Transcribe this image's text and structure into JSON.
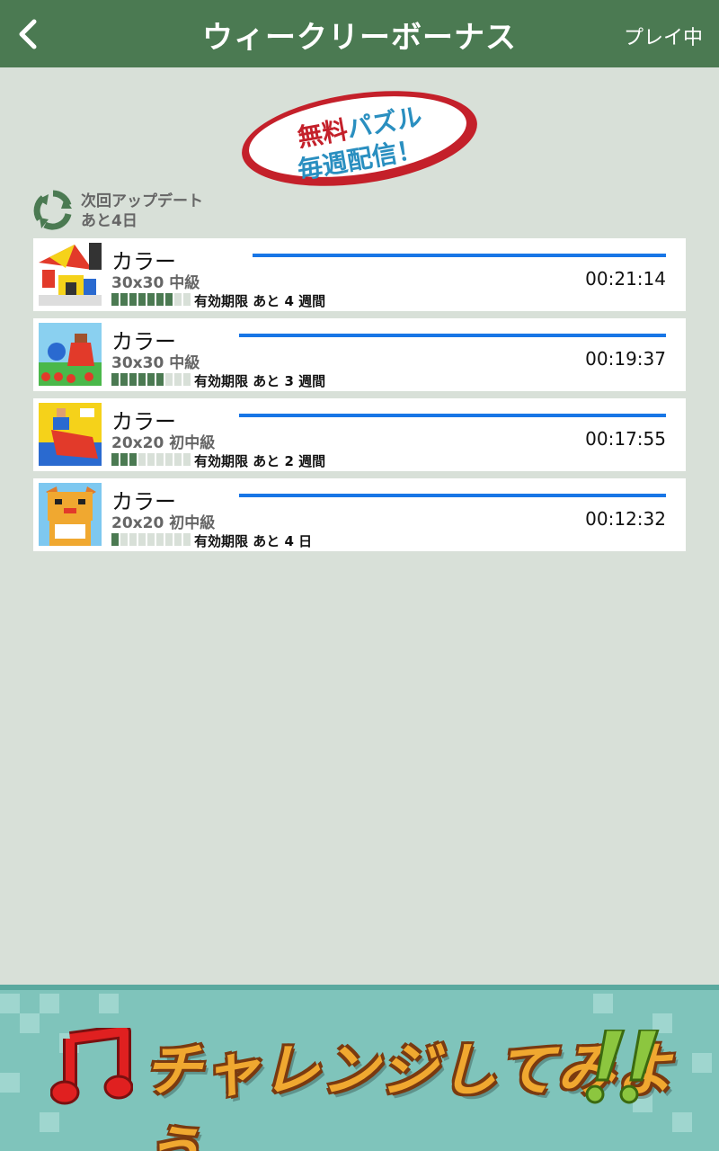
{
  "header": {
    "back_label": "<",
    "title": "ウィークリーボーナス",
    "right_label": "プレイ中"
  },
  "badge": {
    "line1_red": "無料",
    "line1_blue": "パズル",
    "line2": "毎週配信！"
  },
  "update": {
    "line1": "次回アップデート",
    "line2": "あと4日"
  },
  "puzzles": [
    {
      "title": "カラー",
      "size_level": "30x30 中級",
      "time": "00:21:14",
      "expiry": "有効期限 あと 4 週間",
      "level_filled": 7,
      "level_total": 9,
      "thumb": "beach-umbrella"
    },
    {
      "title": "カラー",
      "size_level": "30x30 中級",
      "time": "00:19:37",
      "expiry": "有効期限 あと 3 週間",
      "level_filled": 6,
      "level_total": 9,
      "thumb": "girl-watering"
    },
    {
      "title": "カラー",
      "size_level": "20x20 初中級",
      "time": "00:17:55",
      "expiry": "有効期限 あと 2 週間",
      "level_filled": 3,
      "level_total": 9,
      "thumb": "flamenco"
    },
    {
      "title": "カラー",
      "size_level": "20x20 初中級",
      "time": "00:12:32",
      "expiry": "有効期限 あと 4 日",
      "level_filled": 1,
      "level_total": 9,
      "thumb": "lucky-cat"
    }
  ],
  "banner": {
    "text": "チャレンジしてみよう",
    "icons": [
      "music-note-icon",
      "exclamation-icon"
    ]
  },
  "colors": {
    "header": "#4b7a52",
    "background": "#d8e0d8",
    "progress": "#1876e6",
    "banner_text": "#f0a830"
  }
}
